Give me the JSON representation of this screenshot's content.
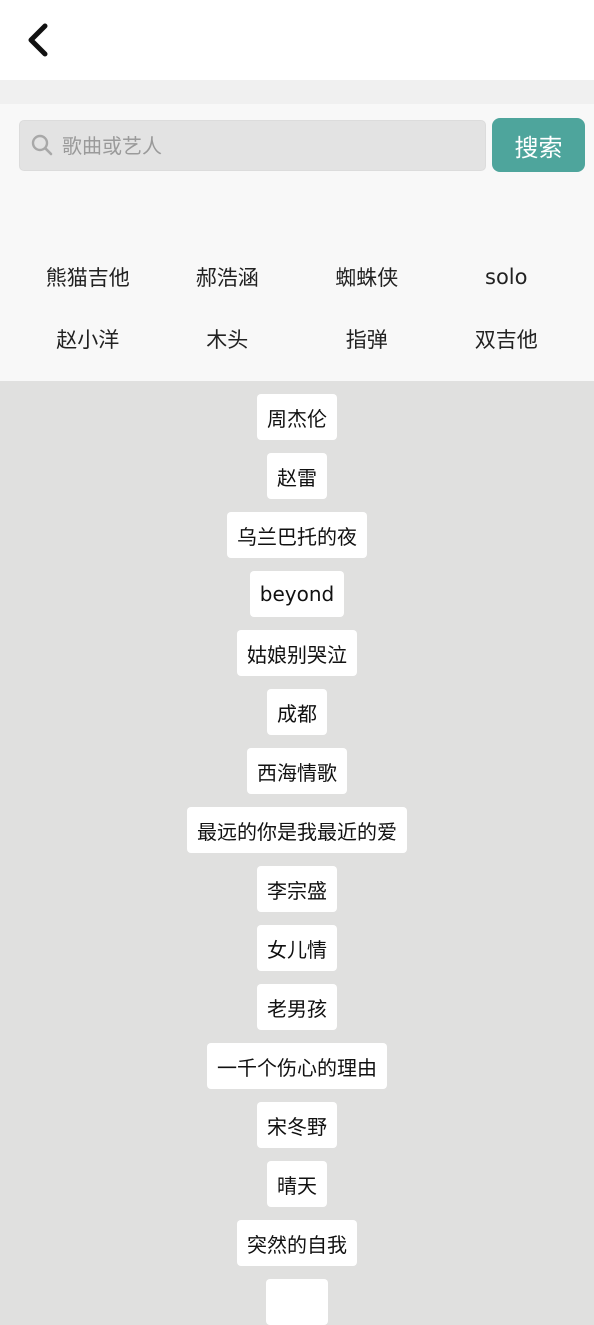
{
  "search": {
    "placeholder": "歌曲或艺人",
    "button_label": "搜索"
  },
  "hot_tags": [
    "熊猫吉他",
    "郝浩涵",
    "蜘蛛侠",
    "solo",
    "赵小洋",
    "木头",
    "指弹",
    "双吉他"
  ],
  "history": [
    "周杰伦",
    "赵雷",
    "乌兰巴托的夜",
    "beyond",
    "姑娘别哭泣",
    "成都",
    "西海情歌",
    "最远的你是我最近的爱",
    "李宗盛",
    "女儿情",
    "老男孩",
    "一千个伤心的理由",
    "宋冬野",
    "晴天",
    "突然的自我",
    ""
  ],
  "colors": {
    "accent": "#4ea59c",
    "page_background": "#e0e0df",
    "panel_background": "#f8f8f8",
    "chip_background": "#ffffff"
  },
  "icons": {
    "back": "chevron-left-icon",
    "search": "search-icon"
  }
}
